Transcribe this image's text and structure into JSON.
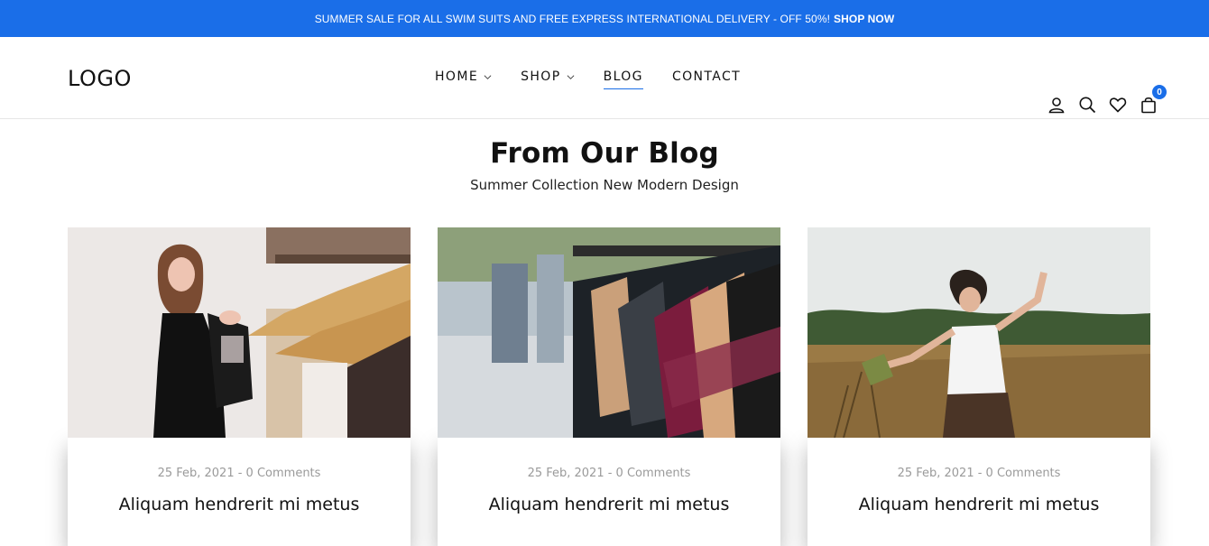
{
  "topbar": {
    "promo_text": "SUMMER SALE FOR ALL SWIM SUITS AND FREE EXPRESS INTERNATIONAL DELIVERY - OFF 50%!",
    "shop_now": "SHOP NOW",
    "background": "#1a6ee8"
  },
  "header": {
    "logo": "LOGO",
    "nav": [
      {
        "label": "HOME",
        "has_dropdown": true
      },
      {
        "label": "SHOP",
        "has_dropdown": true
      },
      {
        "label": "BLOG",
        "active": true
      },
      {
        "label": "CONTACT"
      }
    ],
    "icons": [
      "user-icon",
      "search-icon",
      "heart-icon",
      "cart-icon"
    ],
    "cart_count": "0"
  },
  "blog": {
    "title": "From Our Blog",
    "subtitle": "Summer Collection New Modern Design",
    "posts": [
      {
        "meta": "25 Feb, 2021 - 0 Comments",
        "title": "Aliquam hendrerit mi metus"
      },
      {
        "meta": "25 Feb, 2021 - 0 Comments",
        "title": "Aliquam hendrerit mi metus"
      },
      {
        "meta": "25 Feb, 2021 - 0 Comments",
        "title": "Aliquam hendrerit mi metus"
      }
    ]
  },
  "colors": {
    "accent": "#1a6ee8",
    "text": "#111111",
    "muted": "#9a9a9a"
  }
}
